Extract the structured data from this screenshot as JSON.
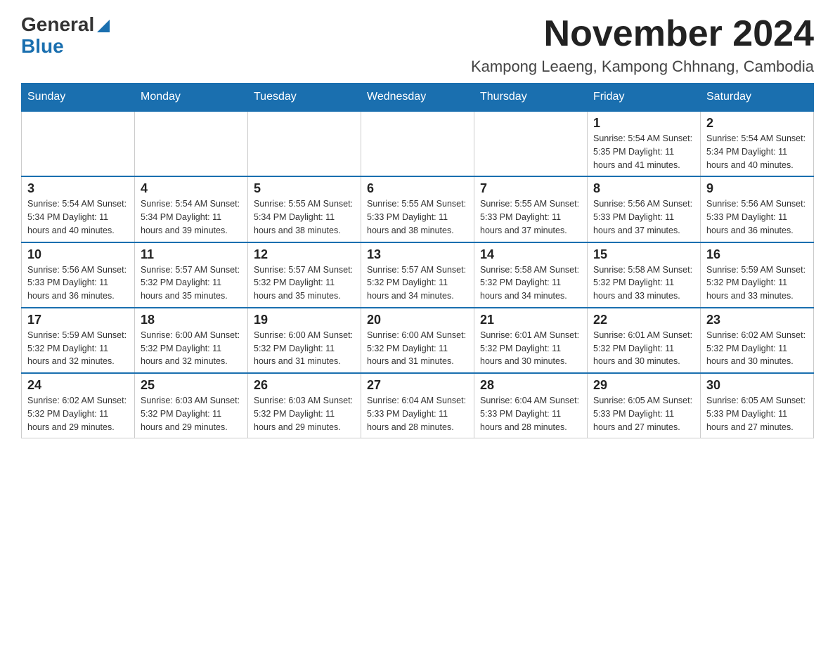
{
  "header": {
    "logo_general": "General",
    "logo_blue": "Blue",
    "title": "November 2024",
    "subtitle": "Kampong Leaeng, Kampong Chhnang, Cambodia"
  },
  "calendar": {
    "days_of_week": [
      "Sunday",
      "Monday",
      "Tuesday",
      "Wednesday",
      "Thursday",
      "Friday",
      "Saturday"
    ],
    "weeks": [
      {
        "days": [
          {
            "number": "",
            "info": ""
          },
          {
            "number": "",
            "info": ""
          },
          {
            "number": "",
            "info": ""
          },
          {
            "number": "",
            "info": ""
          },
          {
            "number": "",
            "info": ""
          },
          {
            "number": "1",
            "info": "Sunrise: 5:54 AM\nSunset: 5:35 PM\nDaylight: 11 hours and 41 minutes."
          },
          {
            "number": "2",
            "info": "Sunrise: 5:54 AM\nSunset: 5:34 PM\nDaylight: 11 hours and 40 minutes."
          }
        ]
      },
      {
        "days": [
          {
            "number": "3",
            "info": "Sunrise: 5:54 AM\nSunset: 5:34 PM\nDaylight: 11 hours and 40 minutes."
          },
          {
            "number": "4",
            "info": "Sunrise: 5:54 AM\nSunset: 5:34 PM\nDaylight: 11 hours and 39 minutes."
          },
          {
            "number": "5",
            "info": "Sunrise: 5:55 AM\nSunset: 5:34 PM\nDaylight: 11 hours and 38 minutes."
          },
          {
            "number": "6",
            "info": "Sunrise: 5:55 AM\nSunset: 5:33 PM\nDaylight: 11 hours and 38 minutes."
          },
          {
            "number": "7",
            "info": "Sunrise: 5:55 AM\nSunset: 5:33 PM\nDaylight: 11 hours and 37 minutes."
          },
          {
            "number": "8",
            "info": "Sunrise: 5:56 AM\nSunset: 5:33 PM\nDaylight: 11 hours and 37 minutes."
          },
          {
            "number": "9",
            "info": "Sunrise: 5:56 AM\nSunset: 5:33 PM\nDaylight: 11 hours and 36 minutes."
          }
        ]
      },
      {
        "days": [
          {
            "number": "10",
            "info": "Sunrise: 5:56 AM\nSunset: 5:33 PM\nDaylight: 11 hours and 36 minutes."
          },
          {
            "number": "11",
            "info": "Sunrise: 5:57 AM\nSunset: 5:32 PM\nDaylight: 11 hours and 35 minutes."
          },
          {
            "number": "12",
            "info": "Sunrise: 5:57 AM\nSunset: 5:32 PM\nDaylight: 11 hours and 35 minutes."
          },
          {
            "number": "13",
            "info": "Sunrise: 5:57 AM\nSunset: 5:32 PM\nDaylight: 11 hours and 34 minutes."
          },
          {
            "number": "14",
            "info": "Sunrise: 5:58 AM\nSunset: 5:32 PM\nDaylight: 11 hours and 34 minutes."
          },
          {
            "number": "15",
            "info": "Sunrise: 5:58 AM\nSunset: 5:32 PM\nDaylight: 11 hours and 33 minutes."
          },
          {
            "number": "16",
            "info": "Sunrise: 5:59 AM\nSunset: 5:32 PM\nDaylight: 11 hours and 33 minutes."
          }
        ]
      },
      {
        "days": [
          {
            "number": "17",
            "info": "Sunrise: 5:59 AM\nSunset: 5:32 PM\nDaylight: 11 hours and 32 minutes."
          },
          {
            "number": "18",
            "info": "Sunrise: 6:00 AM\nSunset: 5:32 PM\nDaylight: 11 hours and 32 minutes."
          },
          {
            "number": "19",
            "info": "Sunrise: 6:00 AM\nSunset: 5:32 PM\nDaylight: 11 hours and 31 minutes."
          },
          {
            "number": "20",
            "info": "Sunrise: 6:00 AM\nSunset: 5:32 PM\nDaylight: 11 hours and 31 minutes."
          },
          {
            "number": "21",
            "info": "Sunrise: 6:01 AM\nSunset: 5:32 PM\nDaylight: 11 hours and 30 minutes."
          },
          {
            "number": "22",
            "info": "Sunrise: 6:01 AM\nSunset: 5:32 PM\nDaylight: 11 hours and 30 minutes."
          },
          {
            "number": "23",
            "info": "Sunrise: 6:02 AM\nSunset: 5:32 PM\nDaylight: 11 hours and 30 minutes."
          }
        ]
      },
      {
        "days": [
          {
            "number": "24",
            "info": "Sunrise: 6:02 AM\nSunset: 5:32 PM\nDaylight: 11 hours and 29 minutes."
          },
          {
            "number": "25",
            "info": "Sunrise: 6:03 AM\nSunset: 5:32 PM\nDaylight: 11 hours and 29 minutes."
          },
          {
            "number": "26",
            "info": "Sunrise: 6:03 AM\nSunset: 5:32 PM\nDaylight: 11 hours and 29 minutes."
          },
          {
            "number": "27",
            "info": "Sunrise: 6:04 AM\nSunset: 5:33 PM\nDaylight: 11 hours and 28 minutes."
          },
          {
            "number": "28",
            "info": "Sunrise: 6:04 AM\nSunset: 5:33 PM\nDaylight: 11 hours and 28 minutes."
          },
          {
            "number": "29",
            "info": "Sunrise: 6:05 AM\nSunset: 5:33 PM\nDaylight: 11 hours and 27 minutes."
          },
          {
            "number": "30",
            "info": "Sunrise: 6:05 AM\nSunset: 5:33 PM\nDaylight: 11 hours and 27 minutes."
          }
        ]
      }
    ]
  }
}
